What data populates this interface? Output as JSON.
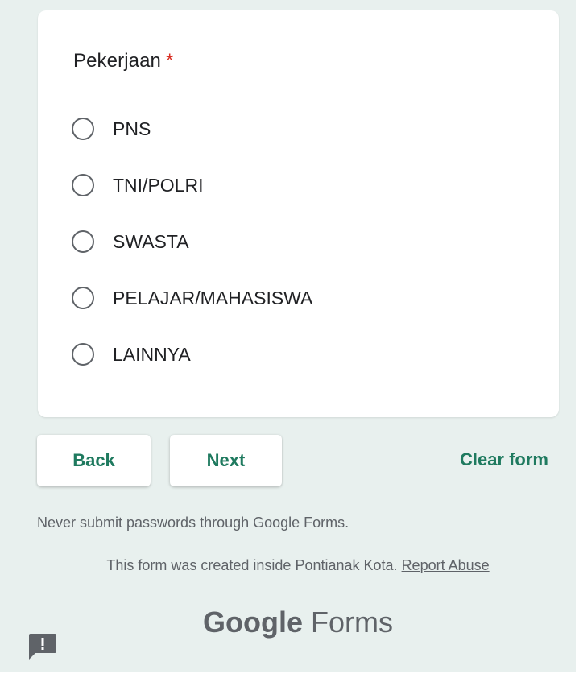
{
  "question": {
    "title": "Pekerjaan",
    "required_mark": "*",
    "options": [
      {
        "label": "PNS"
      },
      {
        "label": "TNI/POLRI"
      },
      {
        "label": "SWASTA"
      },
      {
        "label": "PELAJAR/MAHASISWA"
      },
      {
        "label": "LAINNYA"
      }
    ]
  },
  "navigation": {
    "back_label": "Back",
    "next_label": "Next",
    "clear_label": "Clear form"
  },
  "footer": {
    "warning": "Never submit passwords through Google Forms.",
    "created_text": "This form was created inside Pontianak Kota.",
    "report_link": "Report Abuse",
    "brand_google": "Google",
    "brand_forms": "Forms"
  },
  "icons": {
    "radio": "radio-unchecked-icon",
    "feedback": "feedback-icon"
  },
  "colors": {
    "accent": "#1f7a5f",
    "required": "#d93025",
    "background": "#e8f0ee"
  }
}
